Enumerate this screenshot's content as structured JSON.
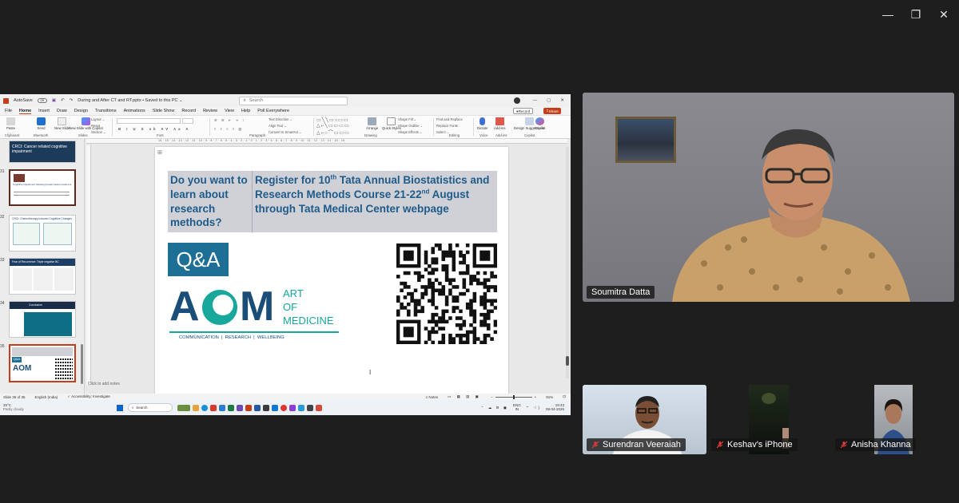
{
  "window_controls": {
    "minimize": "—",
    "restore": "❐",
    "close": "✕"
  },
  "ppt": {
    "autosave": "AutoSave",
    "autosave_state": "Off",
    "doc_title": "During and After CT and RT.pptx • Saved to this PC ⌄",
    "search_placeholder": "Search",
    "record_label": "Record",
    "share_label": "Share",
    "tabs": [
      "File",
      "Home",
      "Insert",
      "Draw",
      "Design",
      "Transitions",
      "Animations",
      "Slide Show",
      "Record",
      "Review",
      "View",
      "Help",
      "Poll Everywhere"
    ],
    "active_tab": "Home",
    "ribbon": {
      "paste": "Paste",
      "send": "Send",
      "bluetooth": "Bluetooth",
      "new_slide": "New Slide",
      "new_slide_copilot": "New Slide with Copilot",
      "layout": "Layout ⌄",
      "reset": "Reset",
      "section": "Section ⌄",
      "text_direction": "Text Direction ⌄",
      "align_text": "Align Text ⌄",
      "convert_smartart": "Convert to SmartArt ⌄",
      "arrange": "Arrange",
      "quick_styles": "Quick Styles",
      "shape_fill": "Shape Fill ⌄",
      "shape_outline": "Shape Outline ⌄",
      "shape_effects": "Shape Effects ⌄",
      "find_replace": "Find and Replace",
      "replace_fonts": "Replace Fonts",
      "select": "Select ⌄",
      "dictate": "Dictate",
      "add_ins": "Add-ins",
      "design_suggestions": "Design Suggestions",
      "copilot": "Copilot",
      "groups": [
        "Clipboard",
        "Bluetooth",
        "Slides",
        "Font",
        "Paragraph",
        "Drawing",
        "Editing",
        "Voice",
        "Add-ins",
        "Copilot"
      ]
    },
    "ruler_marks": "16 · 15 · 14 · 13 · 12 · 11 · 10 · 9 · 8 · 7 · 6 · 5 · 4 · 3 · 2 · 1 · 0 · 1 · 2 · 3 · 4 · 5 · 6 · 7 · 8 · 9 · 10 · 11 · 12 · 13 · 14 · 15 · 16",
    "thumbs": [
      {
        "num": "",
        "title": "CRCI: Cancer related cognitive impairment"
      },
      {
        "num": "31",
        "title": "Cognitive impairment following breast cancer treatment"
      },
      {
        "num": "32",
        "title": "CRCI: Chemotherapy-induced Cognitive Changes"
      },
      {
        "num": "33",
        "title": "Fear of Recurrence: Triple negative BC"
      },
      {
        "num": "34",
        "title": "Conclusion"
      },
      {
        "num": "35",
        "title": ""
      }
    ],
    "notes_placeholder": "Click to add notes",
    "status": {
      "slide_of": "Slide 35 of 35",
      "language": "English (India)",
      "accessibility": "Accessibility: Investigate",
      "notes": "Notes",
      "zoom": "91%"
    }
  },
  "slide": {
    "q_text": "Do you want to learn about research methods?",
    "reg_text_1": "Register for 10",
    "reg_sup_1": "th",
    "reg_text_2": " Tata Annual Biostatistics and Research Methods Course 21-22",
    "reg_sup_2": "nd",
    "reg_text_3": " August through Tata Medical Center webpage",
    "qa": "Q&A",
    "logo_letters_left": "A",
    "logo_letters_right": "M",
    "logo_art": "ART",
    "logo_of": "OF",
    "logo_medicine": "MEDICINE",
    "logo_tagline": "COMMUNICATION  |  RESEARCH  |  WELLBEING"
  },
  "taskbar": {
    "weather_temp": "25°C",
    "weather_desc": "Partly cloudy",
    "search": "Search",
    "lang_1": "ENG",
    "lang_2": "IN",
    "time": "19:43",
    "date": "09-04-2026"
  },
  "participants": [
    {
      "name": "Soumitra Datta",
      "muted": false
    },
    {
      "name": "Surendran Veeraiah",
      "muted": true
    },
    {
      "name": "Keshav's iPhone",
      "muted": true
    },
    {
      "name": "Anisha Khanna",
      "muted": true
    }
  ],
  "colors": {
    "slide_blue": "#1f5b8a",
    "slide_gray_box": "#cfd1d6",
    "qa_teal": "#1d6f96",
    "logo_navy": "#1a4d78",
    "logo_teal": "#17a79b",
    "mute_red": "#d93b3b",
    "ppt_accent": "#c43e1c"
  }
}
